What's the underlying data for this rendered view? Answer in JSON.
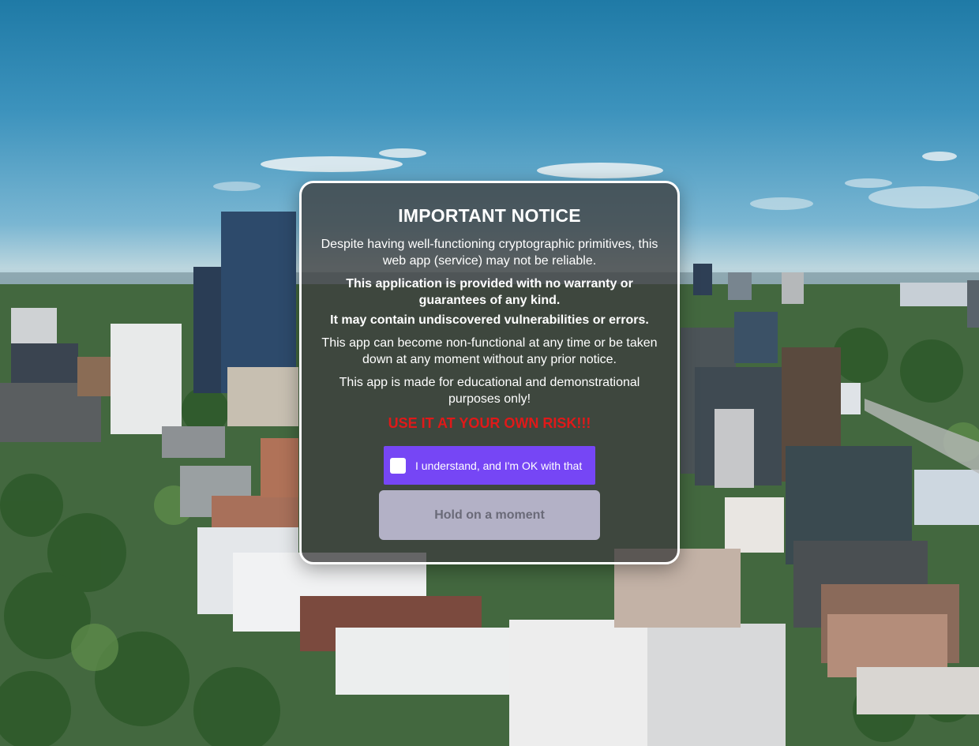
{
  "notice": {
    "title": "IMPORTANT NOTICE",
    "paragraph1": "Despite having well-functioning cryptographic primitives, this web app (service) may not be reliable.",
    "paragraph2": "This application is provided with no warranty or guarantees of any kind.",
    "paragraph3": "It may contain undiscovered vulnerabilities or errors.",
    "paragraph4": "This app can become non-functional at any time or be taken down at any moment without any prior notice.",
    "paragraph5": "This app is made for educational and demonstrational purposes only!",
    "risk": "USE IT AT YOUR OWN RISK!!!",
    "agree_label": "I understand, and I'm OK with that",
    "agree_checked": false,
    "hold_label": "Hold on a moment",
    "hold_enabled": false
  },
  "colors": {
    "accent": "#7646f5",
    "risk": "#e01919",
    "modal_bg": "#3e3e3e",
    "disabled_button": "#b3b1c6"
  }
}
